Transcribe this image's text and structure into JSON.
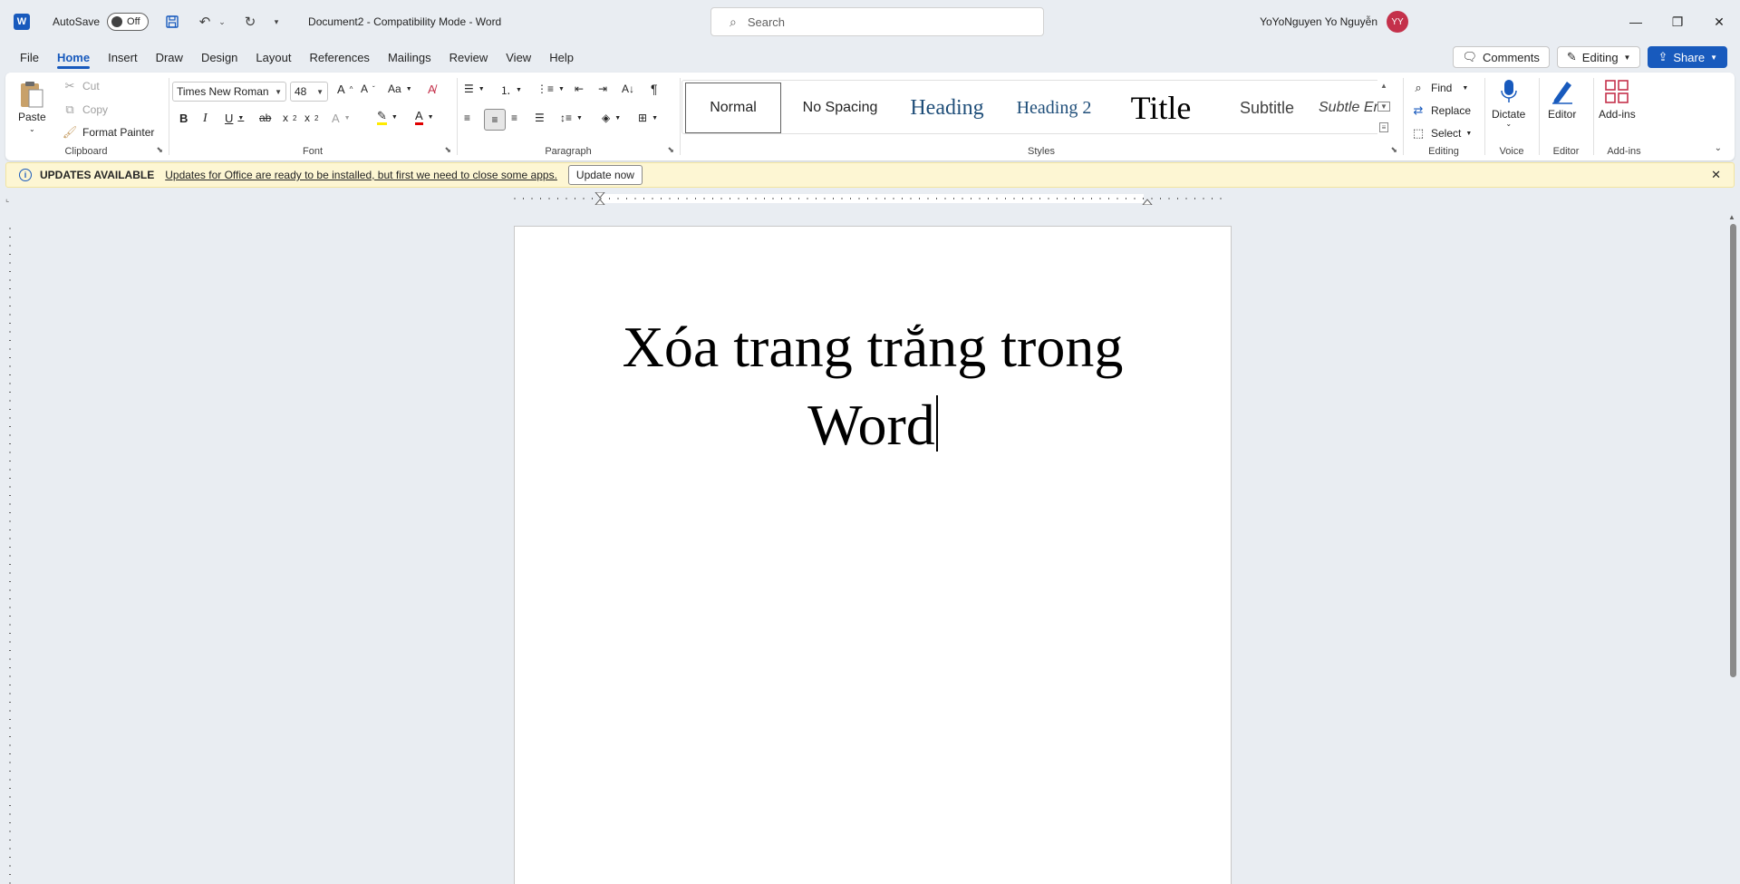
{
  "titlebar": {
    "logo_letter": "W",
    "autosave_label": "AutoSave",
    "autosave_state": "Off",
    "doc_title": "Document2  -  Compatibility Mode  -  Word",
    "search_placeholder": "Search",
    "user_name": "YoYoNguyen Yo Nguyễn",
    "avatar_initials": "YY"
  },
  "tabs": [
    "File",
    "Home",
    "Insert",
    "Draw",
    "Design",
    "Layout",
    "References",
    "Mailings",
    "Review",
    "View",
    "Help"
  ],
  "tab_actions": {
    "comments": "Comments",
    "editing": "Editing",
    "share": "Share"
  },
  "ribbon": {
    "clipboard": {
      "label": "Clipboard",
      "paste": "Paste",
      "cut": "Cut",
      "copy": "Copy",
      "format_painter": "Format Painter"
    },
    "font": {
      "label": "Font",
      "font_name": "Times New Roman",
      "font_size": "48"
    },
    "paragraph": {
      "label": "Paragraph"
    },
    "styles": {
      "label": "Styles",
      "items": [
        "Normal",
        "No Spacing",
        "Heading",
        "Heading 2",
        "Title",
        "Subtitle",
        "Subtle Emph..."
      ]
    },
    "editing": {
      "label": "Editing",
      "find": "Find",
      "replace": "Replace",
      "select": "Select"
    },
    "voice": {
      "label": "Voice",
      "dictate": "Dictate"
    },
    "editor": {
      "label": "Editor",
      "editor": "Editor"
    },
    "addins": {
      "label": "Add-ins",
      "addins": "Add-ins"
    }
  },
  "update_bar": {
    "title": "UPDATES AVAILABLE",
    "message": "Updates for Office are ready to be installed, but first we need to close some apps.",
    "button": "Update now"
  },
  "document": {
    "line1": "Xóa trang trắng trong",
    "line2": "Word"
  },
  "colors": {
    "accent": "#185abd",
    "avatar": "#c4314b",
    "update_bar": "#fdf6d3"
  }
}
